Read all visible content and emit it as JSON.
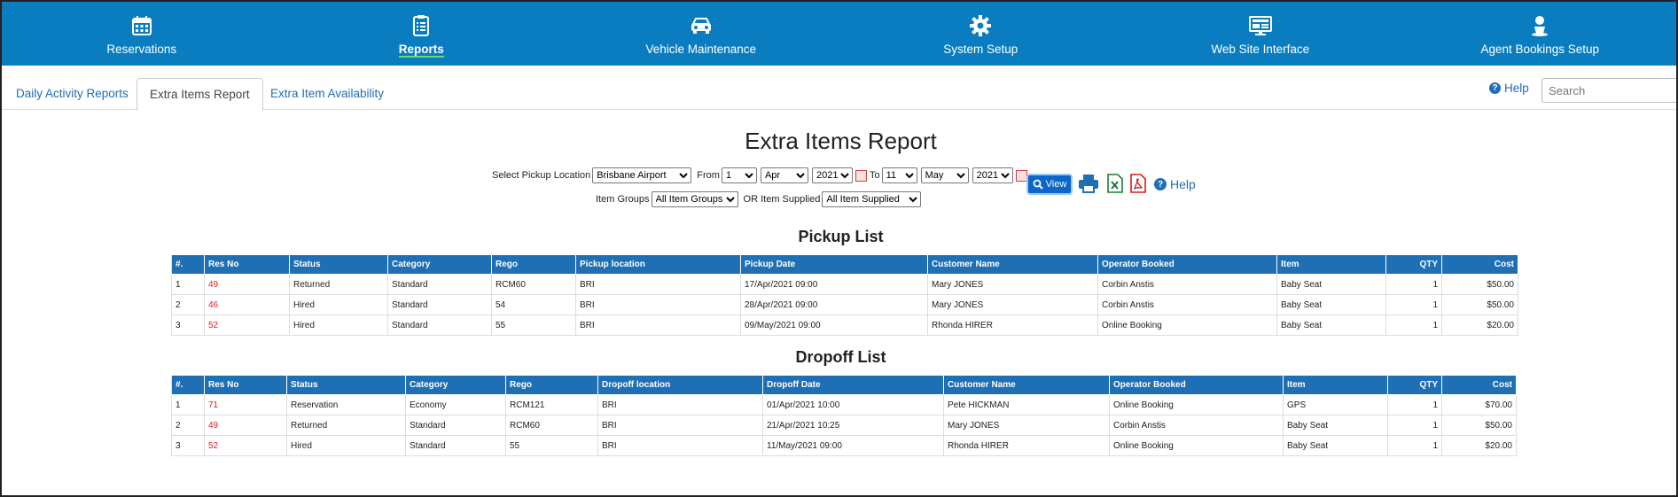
{
  "nav": {
    "items": [
      {
        "label": "Reservations",
        "icon": "calendar-icon"
      },
      {
        "label": "Reports",
        "icon": "clipboard-icon"
      },
      {
        "label": "Vehicle Maintenance",
        "icon": "car-icon"
      },
      {
        "label": "System Setup",
        "icon": "gear-icon"
      },
      {
        "label": "Web Site Interface",
        "icon": "monitor-icon"
      },
      {
        "label": "Agent Bookings Setup",
        "icon": "agent-icon"
      }
    ],
    "active": "Reports"
  },
  "tabs": {
    "items": [
      "Daily Activity Reports",
      "Extra Items Report",
      "Extra Item Availability"
    ],
    "active": "Extra Items Report",
    "help": "Help",
    "search_placeholder": "Search"
  },
  "report": {
    "title": "Extra Items Report",
    "pickup_location_label": "Select Pickup Location",
    "pickup_location": "Brisbane Airport",
    "from_label": "From",
    "from_day": "1",
    "from_month": "Apr",
    "from_year": "2021",
    "to_label": "To",
    "to_day": "11",
    "to_month": "May",
    "to_year": "2021",
    "item_groups_label": "Item Groups",
    "item_groups": "All Item Groups",
    "or_label": "OR Item Supplied",
    "item_supplied": "All Item Supplied",
    "view_label": "View",
    "help": "Help"
  },
  "pickup": {
    "title": "Pickup List",
    "headers": [
      "#.",
      "Res No",
      "Status",
      "Category",
      "Rego",
      "Pickup location",
      "Pickup Date",
      "Customer Name",
      "Operator Booked",
      "Item",
      "QTY",
      "Cost"
    ],
    "rows": [
      [
        "1",
        "49",
        "Returned",
        "Standard",
        "RCM60",
        "BRI",
        "17/Apr/2021 09:00",
        "Mary JONES",
        "Corbin Anstis",
        "Baby Seat",
        "1",
        "$50.00"
      ],
      [
        "2",
        "46",
        "Hired",
        "Standard",
        "54",
        "BRI",
        "28/Apr/2021 09:00",
        "Mary JONES",
        "Corbin Anstis",
        "Baby Seat",
        "1",
        "$50.00"
      ],
      [
        "3",
        "52",
        "Hired",
        "Standard",
        "55",
        "BRI",
        "09/May/2021 09:00",
        "Rhonda HIRER",
        "Online Booking",
        "Baby Seat",
        "1",
        "$20.00"
      ]
    ]
  },
  "dropoff": {
    "title": "Dropoff List",
    "headers": [
      "#.",
      "Res No",
      "Status",
      "Category",
      "Rego",
      "Dropoff location",
      "Dropoff Date",
      "Customer Name",
      "Operator Booked",
      "Item",
      "QTY",
      "Cost"
    ],
    "rows": [
      [
        "1",
        "71",
        "Reservation",
        "Economy",
        "RCM121",
        "BRI",
        "01/Apr/2021 10:00",
        "Pete HICKMAN",
        "Online Booking",
        "GPS",
        "1",
        "$70.00"
      ],
      [
        "2",
        "49",
        "Returned",
        "Standard",
        "RCM60",
        "BRI",
        "21/Apr/2021 10:25",
        "Mary JONES",
        "Corbin Anstis",
        "Baby Seat",
        "1",
        "$50.00"
      ],
      [
        "3",
        "52",
        "Hired",
        "Standard",
        "55",
        "BRI",
        "11/May/2021 09:00",
        "Rhonda HIRER",
        "Online Booking",
        "Baby Seat",
        "1",
        "$20.00"
      ]
    ]
  }
}
